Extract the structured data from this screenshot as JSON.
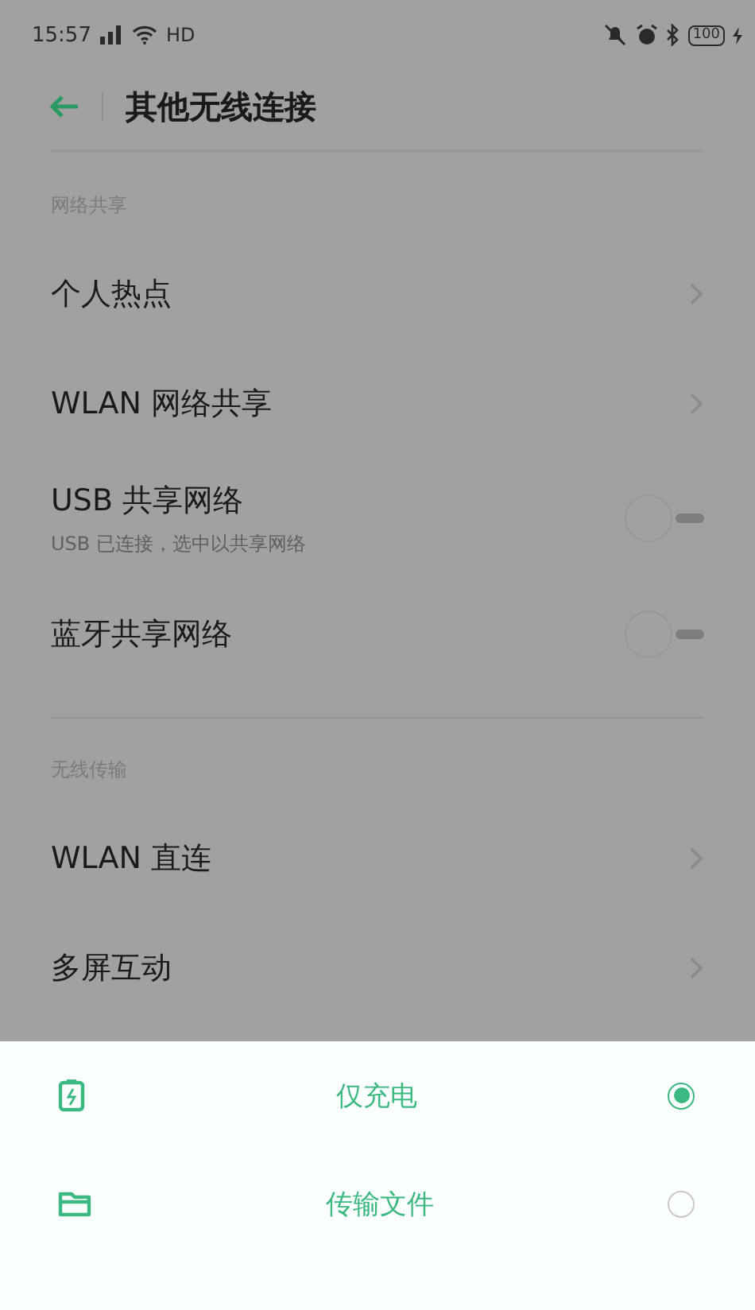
{
  "status_bar": {
    "time": "15:57",
    "network": "HD",
    "battery": "100"
  },
  "header": {
    "title": "其他无线连接"
  },
  "sections": [
    {
      "label": "网络共享",
      "items": [
        {
          "kind": "link",
          "title": "个人热点"
        },
        {
          "kind": "link",
          "title": "WLAN 网络共享"
        },
        {
          "kind": "toggle",
          "title": "USB 共享网络",
          "subtitle": "USB 已连接，选中以共享网络",
          "on": false
        },
        {
          "kind": "toggle",
          "title": "蓝牙共享网络",
          "on": false
        }
      ]
    },
    {
      "label": "无线传输",
      "items": [
        {
          "kind": "link",
          "title": "WLAN 直连"
        },
        {
          "kind": "link",
          "title": "多屏互动"
        }
      ]
    }
  ],
  "sheet": {
    "options": [
      {
        "kind": "battery",
        "label": "仅充电",
        "selected": true
      },
      {
        "kind": "folder",
        "label": "传输文件",
        "selected": false
      }
    ]
  }
}
